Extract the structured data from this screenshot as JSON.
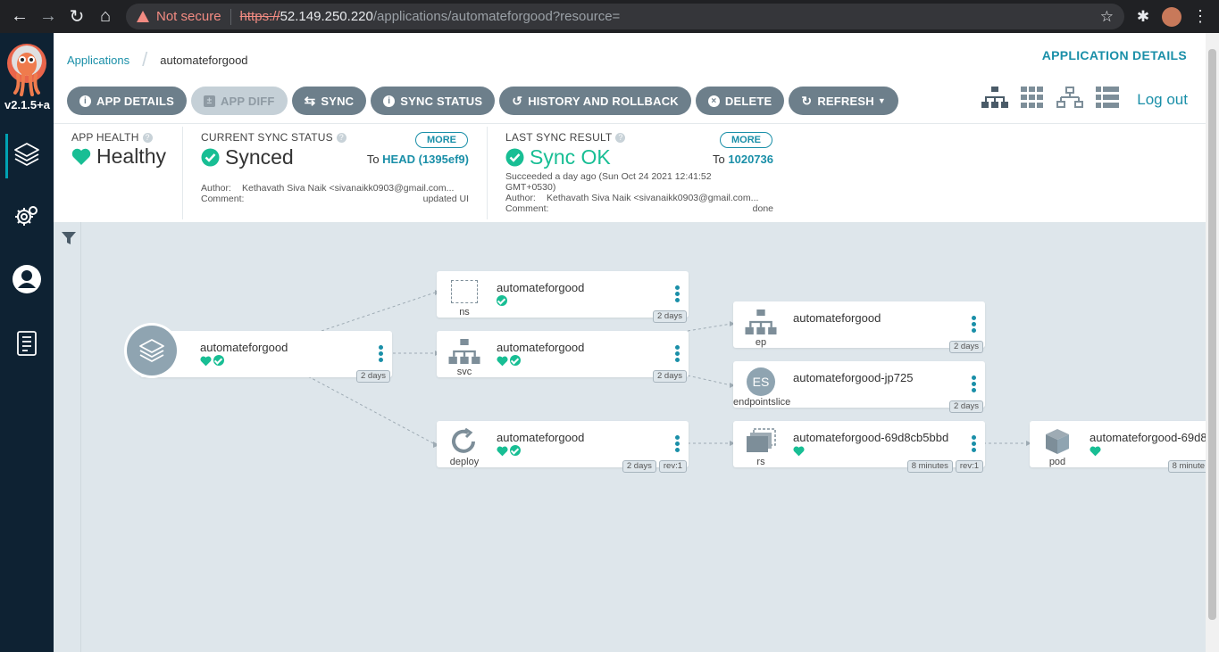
{
  "browser": {
    "security_label": "Not secure",
    "url_scheme": "https://",
    "url_host": "52.149.250.220",
    "url_path": "/applications/automateforgood?resource="
  },
  "sidebar": {
    "version": "v2.1.5+a",
    "items": [
      "applications",
      "settings",
      "user-info",
      "docs"
    ]
  },
  "breadcrumb": {
    "root": "Applications",
    "current": "automateforgood"
  },
  "header": {
    "title": "APPLICATION DETAILS",
    "logout": "Log out"
  },
  "toolbar": {
    "app_details": "APP DETAILS",
    "app_diff": "APP DIFF",
    "sync": "SYNC",
    "sync_status": "SYNC STATUS",
    "history": "HISTORY AND ROLLBACK",
    "delete": "DELETE",
    "refresh": "REFRESH"
  },
  "health": {
    "label": "APP HEALTH",
    "value": "Healthy"
  },
  "sync_status": {
    "label": "CURRENT SYNC STATUS",
    "more": "MORE",
    "value": "Synced",
    "to_prefix": "To",
    "to_ref": "HEAD (1395ef9)",
    "author_label": "Author:",
    "author": "Kethavath Siva Naik <sivanaikk0903@gmail.com...",
    "comment_label": "Comment:",
    "comment": "updated UI"
  },
  "last_sync": {
    "label": "LAST SYNC RESULT",
    "more": "MORE",
    "value": "Sync OK",
    "to_prefix": "To",
    "to_ref": "1020736",
    "time_line1": "Succeeded a day ago (Sun Oct 24 2021 12:41:52",
    "time_line2": "GMT+0530)",
    "author_label": "Author:",
    "author": "Kethavath Siva Naik <sivanaikk0903@gmail.com...",
    "comment_label": "Comment:",
    "comment": "done"
  },
  "tree": {
    "app": {
      "name": "automateforgood",
      "age": "2 days"
    },
    "ns": {
      "kind": "ns",
      "name": "automateforgood",
      "age": "2 days"
    },
    "svc": {
      "kind": "svc",
      "name": "automateforgood",
      "age": "2 days"
    },
    "deploy": {
      "kind": "deploy",
      "name": "automateforgood",
      "age": "2 days",
      "rev": "rev:1"
    },
    "ep": {
      "kind": "ep",
      "name": "automateforgood",
      "age": "2 days"
    },
    "endpointslice": {
      "kind": "endpointslice",
      "badge": "ES",
      "name": "automateforgood-jp725",
      "age": "2 days"
    },
    "rs": {
      "kind": "rs",
      "name": "automateforgood-69d8cb5bbd",
      "age": "8 minutes",
      "rev": "rev:1"
    },
    "pod": {
      "kind": "pod",
      "name": "automateforgood-69d8",
      "age": "8 minute"
    }
  },
  "colors": {
    "sidebar": "#0e2233",
    "accent": "#1a8fa8",
    "healthy": "#18be94",
    "button": "#6d7f8b"
  }
}
